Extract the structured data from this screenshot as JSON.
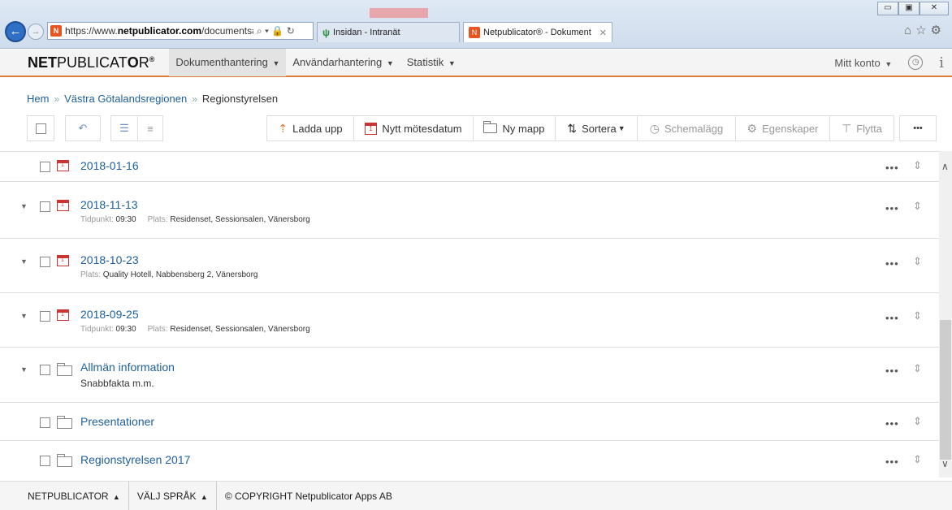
{
  "browser": {
    "url_prefix": "https://www.",
    "url_domain": "netpublicator.com",
    "url_path": "/documents#",
    "tabs": [
      {
        "label": "Insidan - Intranät"
      },
      {
        "label": "Netpublicator® - Dokument"
      }
    ],
    "window_buttons": {
      "minimize": "▭",
      "maximize": "▣",
      "close": "✕"
    }
  },
  "app": {
    "logo_bold": "NET",
    "logo_rest": "PUBLICAT",
    "logo_o": "O",
    "logo_r": "R",
    "logo_reg": "®",
    "menu": [
      {
        "label": "Dokumenthantering"
      },
      {
        "label": "Användarhantering"
      },
      {
        "label": "Statistik"
      }
    ],
    "account_label": "Mitt konto",
    "info_label": "i"
  },
  "breadcrumb": {
    "home": "Hem",
    "region": "Västra Götalandsregionen",
    "current": "Regionstyrelsen",
    "separator": "»"
  },
  "toolbar": {
    "upload": "Ladda upp",
    "new_meeting": "Nytt mötesdatum",
    "new_folder": "Ny mapp",
    "sort": "Sortera",
    "schedule": "Schemalägg",
    "properties": "Egenskaper",
    "move": "Flytta",
    "more": "•••"
  },
  "rows": [
    {
      "title": "2018-01-16",
      "type": "meeting"
    },
    {
      "title": "2018-11-13",
      "type": "meeting",
      "time_label": "Tidpunkt:",
      "time": "09:30",
      "place_label": "Plats:",
      "place": "Residenset, Sessionsalen, Vänersborg"
    },
    {
      "title": "2018-10-23",
      "type": "meeting",
      "place_label": "Plats:",
      "place": "Quality Hotell, Nabbensberg 2, Vänersborg"
    },
    {
      "title": "2018-09-25",
      "type": "meeting",
      "time_label": "Tidpunkt:",
      "time": "09:30",
      "place_label": "Plats:",
      "place": "Residenset, Sessionsalen, Vänersborg"
    },
    {
      "title": "Allmän information",
      "type": "folder",
      "subtitle": "Snabbfakta m.m."
    },
    {
      "title": "Presentationer",
      "type": "folder"
    },
    {
      "title": "Regionstyrelsen 2017",
      "type": "folder"
    }
  ],
  "row_actions": {
    "more": "•••",
    "sort": "⇕"
  },
  "footer": {
    "netpublicator": "NETPUBLICATOR",
    "language": "VÄLJ SPRÅK",
    "copyright": "© COPYRIGHT Netpublicator Apps AB"
  },
  "colors": {
    "accent": "#e27d38",
    "link": "#1e5f9a",
    "calendar": "#cc3333"
  }
}
